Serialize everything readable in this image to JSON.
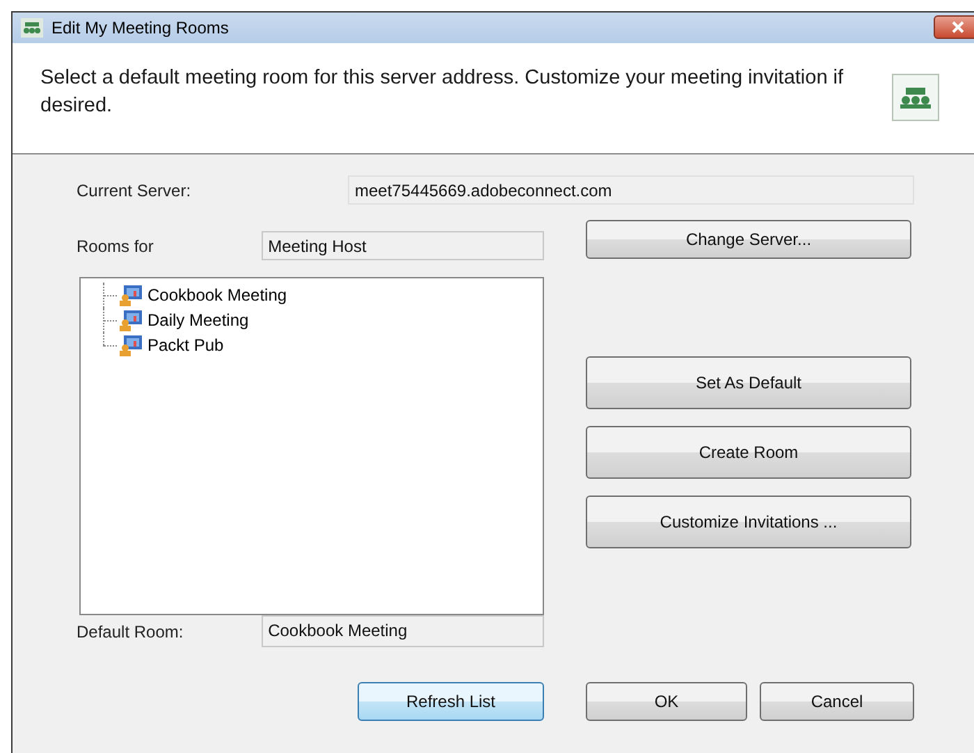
{
  "window": {
    "title": "Edit My Meeting Rooms"
  },
  "header": {
    "text": "Select a default meeting room for this server address. Customize your meeting invitation if desired."
  },
  "current_server": {
    "label": "Current Server:",
    "value": "meet75445669.adobeconnect.com"
  },
  "rooms_for": {
    "label": "Rooms for",
    "value": "Meeting Host"
  },
  "rooms": [
    {
      "label": "Cookbook Meeting"
    },
    {
      "label": "Daily Meeting"
    },
    {
      "label": "Packt Pub"
    }
  ],
  "default_room": {
    "label": "Default Room:",
    "value": "Cookbook Meeting"
  },
  "side_buttons": [
    {
      "label": "Change Server...",
      "kind": "top"
    },
    {
      "label": "Set As Default",
      "kind": "large"
    },
    {
      "label": "Create Room",
      "kind": "large"
    },
    {
      "label": "Customize Invitations ...",
      "kind": "large"
    }
  ],
  "bottom_buttons": [
    {
      "label": "Refresh List",
      "focused": true
    },
    {
      "label": "OK",
      "focused": false
    },
    {
      "label": "Cancel",
      "focused": false
    }
  ]
}
